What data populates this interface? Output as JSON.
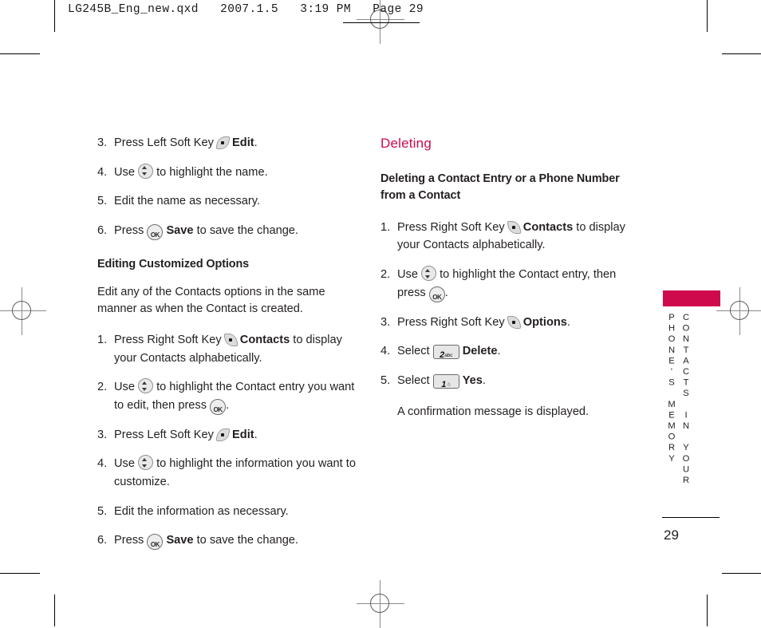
{
  "slug": "LG245B_Eng_new.qxd   2007.1.5   3:19 PM   Page 29",
  "left_column": {
    "steps_top": [
      {
        "num": "3.",
        "pre": "Press Left Soft Key",
        "icon": "left-soft-key-icon",
        "bold": "Edit",
        "post": "."
      },
      {
        "num": "4.",
        "pre": "Use",
        "icon": "nav-updown-icon",
        "post": "to highlight the name."
      },
      {
        "num": "5.",
        "pre": "Edit the name as necessary.",
        "icon": "",
        "post": ""
      },
      {
        "num": "6.",
        "pre": "Press",
        "icon": "ok-key-icon",
        "bold": "Save",
        "post": "to save the change."
      }
    ],
    "sub_head": "Editing Customized Options",
    "paragraph": "Edit any of the Contacts options in the same manner as when the Contact is created.",
    "steps_bottom": [
      {
        "num": "1.",
        "pre": "Press Right Soft Key",
        "icon": "right-soft-key-icon",
        "bold": "Contacts",
        "post": "to display your Contacts alphabetically."
      },
      {
        "num": "2.",
        "pre": "Use",
        "icon": "nav-updown-icon",
        "post": "to highlight the Contact entry you want to edit, then press",
        "icon2": "ok-key-icon",
        "post2": "."
      },
      {
        "num": "3.",
        "pre": "Press Left Soft Key",
        "icon": "left-soft-key-icon",
        "bold": "Edit",
        "post": "."
      },
      {
        "num": "4.",
        "pre": "Use",
        "icon": "nav-updown-icon",
        "post": "to highlight the information you want to customize."
      },
      {
        "num": "5.",
        "pre": "Edit the information as necessary.",
        "icon": "",
        "post": ""
      },
      {
        "num": "6.",
        "pre": "Press",
        "icon": "ok-key-icon",
        "bold": "Save",
        "post": "to save the change."
      }
    ]
  },
  "right_column": {
    "section_title": "Deleting",
    "sub_head": "Deleting a Contact Entry or a Phone Number from a Contact",
    "steps": [
      {
        "num": "1.",
        "pre": "Press Right Soft Key",
        "icon": "right-soft-key-icon",
        "bold": "Contacts",
        "post": "to display your Contacts alphabetically."
      },
      {
        "num": "2.",
        "pre": "Use",
        "icon": "nav-updown-icon",
        "post": "to highlight the Contact entry, then press",
        "icon2": "ok-key-icon",
        "post2": "."
      },
      {
        "num": "3.",
        "pre": "Press Right Soft Key",
        "icon": "right-soft-key-icon",
        "bold": "Options",
        "post": "."
      },
      {
        "num": "4.",
        "pre": "Select",
        "icon": "key-2-abc-icon",
        "bold": "Delete",
        "post": "."
      },
      {
        "num": "5.",
        "pre": "Select",
        "icon": "key-1-icon",
        "bold": "Yes",
        "post": "."
      }
    ],
    "note": "A confirmation message is displayed."
  },
  "keys": {
    "key2_digit": "2",
    "key2_sub": "abc",
    "key1_digit": "1",
    "ok_label": "OK"
  },
  "side_tab": {
    "line1": "CONTACTS IN YOUR",
    "line2": "PHONE'S MEMORY",
    "bar_color": "#cf0a4c"
  },
  "page_number": "29",
  "colors": {
    "accent": "#cf0a4c",
    "text": "#231f20"
  }
}
